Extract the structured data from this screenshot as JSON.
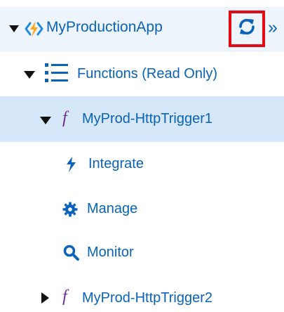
{
  "tree": {
    "app": {
      "label": "MyProductionApp",
      "icon": "function-app-icon",
      "expanded": true,
      "actions": {
        "refresh_icon": "refresh-icon",
        "expand_icon": "double-chevron-right-icon",
        "expand_label": "»"
      }
    },
    "functions": {
      "label": "Functions (Read Only)",
      "icon": "list-icon",
      "expanded": true
    },
    "function1": {
      "label": "MyProd-HttpTrigger1",
      "icon_label": "f",
      "expanded": true,
      "children": [
        {
          "label": "Integrate",
          "icon": "lightning-icon"
        },
        {
          "label": "Manage",
          "icon": "gear-icon"
        },
        {
          "label": "Monitor",
          "icon": "search-icon"
        }
      ]
    },
    "function2": {
      "label": "MyProd-HttpTrigger2",
      "icon_label": "f",
      "expanded": false
    }
  },
  "colors": {
    "link_blue": "#0a63b8",
    "function_purple": "#6b2c91",
    "selected_background": "#d5e7f8",
    "app_background": "#eef4fb",
    "highlight_red": "#e50914"
  }
}
